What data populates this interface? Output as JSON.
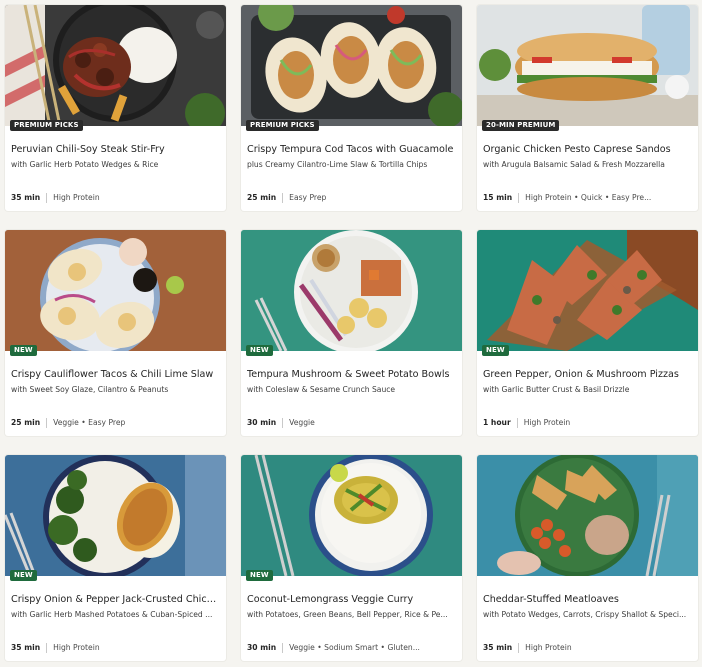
{
  "recipes": [
    {
      "badge": "PREMIUM PICKS",
      "badge_color": "#2a2a2a",
      "title": "Peruvian Chili-Soy Steak Stir-Fry",
      "subtitle": "with Garlic Herb Potato Wedges & Rice",
      "time": "35 min",
      "tags": "High Protein"
    },
    {
      "badge": "PREMIUM PICKS",
      "badge_color": "#2a2a2a",
      "title": "Crispy Tempura Cod Tacos with Guacamole",
      "subtitle": "plus Creamy Cilantro-Lime Slaw & Tortilla Chips",
      "time": "25 min",
      "tags": "Easy Prep"
    },
    {
      "badge": "20-MIN PREMIUM",
      "badge_color": "#2a2a2a",
      "title": "Organic Chicken Pesto Caprese Sandos",
      "subtitle": "with Arugula Balsamic Salad & Fresh Mozzarella",
      "time": "15 min",
      "tags": "High Protein • Quick • Easy Pre..."
    },
    {
      "badge": "NEW",
      "badge_color": "#1f6b3d",
      "title": "Crispy Cauliflower Tacos & Chili Lime Slaw",
      "subtitle": "with Sweet Soy Glaze, Cilantro & Peanuts",
      "time": "25 min",
      "tags": "Veggie • Easy Prep"
    },
    {
      "badge": "NEW",
      "badge_color": "#1f6b3d",
      "title": "Tempura Mushroom & Sweet Potato Bowls",
      "subtitle": "with Coleslaw & Sesame Crunch Sauce",
      "time": "30 min",
      "tags": "Veggie"
    },
    {
      "badge": "NEW",
      "badge_color": "#1f6b3d",
      "title": "Green Pepper, Onion & Mushroom Pizzas",
      "subtitle": "with Garlic Butter Crust & Basil Drizzle",
      "time": "1 hour",
      "tags": "High Protein"
    },
    {
      "badge": "NEW",
      "badge_color": "#1f6b3d",
      "title": "Crispy Onion & Pepper Jack-Crusted Chick...",
      "subtitle": "with Garlic Herb Mashed Potatoes & Cuban-Spiced ...",
      "time": "35 min",
      "tags": "High Protein"
    },
    {
      "badge": "NEW",
      "badge_color": "#1f6b3d",
      "title": "Coconut-Lemongrass Veggie Curry",
      "subtitle": "with Potatoes, Green Beans, Bell Pepper, Rice & Pe...",
      "time": "30 min",
      "tags": "Veggie • Sodium Smart • Gluten..."
    },
    {
      "badge": "",
      "badge_color": "",
      "title": "Cheddar-Stuffed Meatloaves",
      "subtitle": "with Potato Wedges, Carrots, Crispy Shallot & Speci...",
      "time": "35 min",
      "tags": "High Protein"
    }
  ]
}
